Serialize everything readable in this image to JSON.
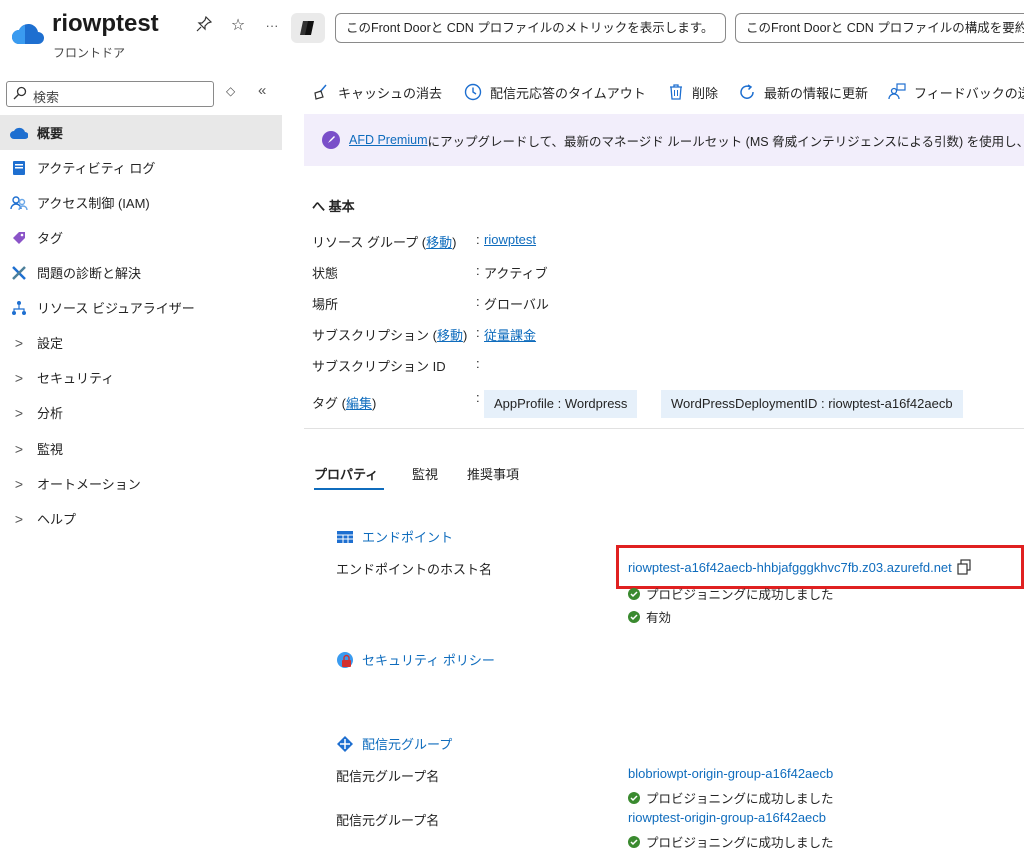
{
  "header": {
    "title": "riowptest",
    "subtitle": "フロントドア",
    "prompts": [
      "このFront Doorと CDN プロファイルのメトリックを表示します。",
      "このFront Doorと CDN プロファイルの構成を要約"
    ]
  },
  "sidebar": {
    "search_placeholder": "検索",
    "items": [
      {
        "label": "概要",
        "icon": "cloud-icon",
        "active": true
      },
      {
        "label": "アクティビティ ログ",
        "icon": "activity-log-icon"
      },
      {
        "label": "アクセス制御 (IAM)",
        "icon": "people-icon"
      },
      {
        "label": "タグ",
        "icon": "tag-icon"
      },
      {
        "label": "問題の診断と解決",
        "icon": "tools-icon"
      },
      {
        "label": "リソース ビジュアライザー",
        "icon": "hierarchy-icon"
      },
      {
        "label": "設定",
        "expandable": true
      },
      {
        "label": "セキュリティ",
        "expandable": true
      },
      {
        "label": "分析",
        "expandable": true
      },
      {
        "label": "監視",
        "expandable": true
      },
      {
        "label": "オートメーション",
        "expandable": true
      },
      {
        "label": "ヘルプ",
        "expandable": true
      }
    ]
  },
  "toolbar": {
    "purge": "キャッシュの消去",
    "timeout": "配信元応答のタイムアウト",
    "delete": "削除",
    "refresh": "最新の情報に更新",
    "feedback": "フィードバックの送"
  },
  "banner": {
    "link": "AFD Premium",
    "text": " にアップグレードして、最新のマネージド ルールセット (MS 脅威インテリジェンスによる引数) を使用し、"
  },
  "essentials": {
    "toggle": "へ 基本",
    "rg_label_pre": "リソース グループ (",
    "rg_move": "移動",
    "rg_label_post": ")",
    "rg_value": "riowptest",
    "state_label": "状態",
    "state_value": "アクティブ",
    "location_label": "場所",
    "location_value": "グローバル",
    "sub_label_pre": "サブスクリプション (",
    "sub_move": "移動",
    "sub_label_post": ")",
    "sub_value": "従量課金",
    "subid_label": "サブスクリプション ID",
    "subid_value": "",
    "tags_label_pre": "タグ (",
    "tags_edit": "編集",
    "tags_label_post": ")",
    "tag1": "AppProfile : Wordpress",
    "tag2": "WordPressDeploymentID : riowptest-a16f42aecb",
    "colon": ":"
  },
  "tabs": [
    "プロパティ",
    "監視",
    "推奨事項"
  ],
  "properties": {
    "endpoint_section": "エンドポイント",
    "endpoint_label": "エンドポイントのホスト名",
    "endpoint_value": "riowptest-a16f42aecb-hhbjafgggkhvc7fb.z03.azurefd.net",
    "endpoint_status1": "プロビジョニングに成功しました",
    "endpoint_status2": "有効",
    "security_section": "セキュリティ ポリシー",
    "origin_section": "配信元グループ",
    "origin_label": "配信元グループ名",
    "origin1_value": "blobriowpt-origin-group-a16f42aecb",
    "origin1_status": "プロビジョニングに成功しました",
    "origin2_value": "riowptest-origin-group-a16f42aecb",
    "origin2_status": "プロビジョニングに成功しました"
  },
  "colors": {
    "link": "#0f6cbd",
    "banner_bg": "#f2eefb",
    "highlight": "#e02020",
    "success": "#3a8a2f"
  }
}
